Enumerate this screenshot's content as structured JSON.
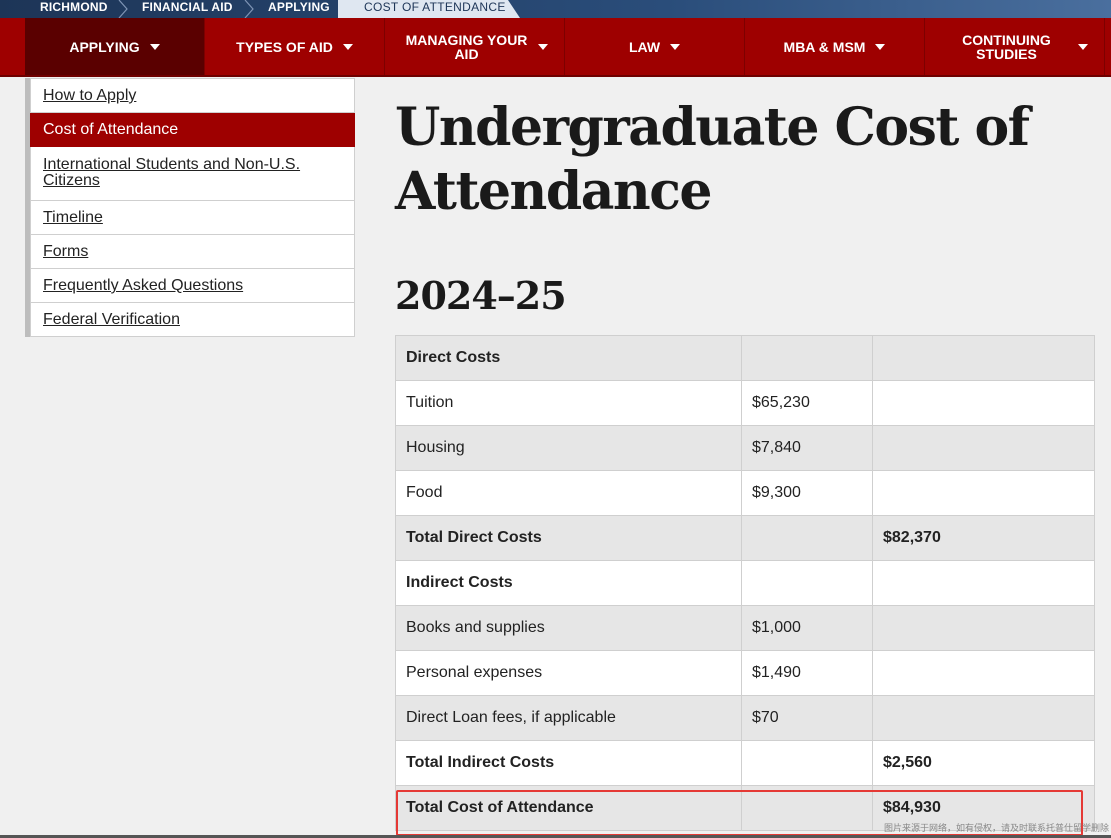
{
  "breadcrumb": {
    "items": [
      "RICHMOND",
      "FINANCIAL AID",
      "APPLYING"
    ],
    "current": "COST OF ATTENDANCE"
  },
  "nav": {
    "items": [
      {
        "label": "APPLYING",
        "active": true
      },
      {
        "label": "TYPES OF AID"
      },
      {
        "label": "MANAGING YOUR AID"
      },
      {
        "label": "LAW"
      },
      {
        "label": "MBA & MSM"
      },
      {
        "label": "CONTINUING STUDIES"
      }
    ]
  },
  "sidebar": {
    "items": [
      {
        "label": "How to Apply"
      },
      {
        "label": "Cost of Attendance",
        "active": true
      },
      {
        "label": "International Students and Non-U.S. Citizens"
      },
      {
        "label": "Timeline"
      },
      {
        "label": "Forms"
      },
      {
        "label": "Frequently Asked Questions"
      },
      {
        "label": "Federal Verification"
      }
    ]
  },
  "main": {
    "title": "Undergraduate Cost of Attendance",
    "year": "2024–25",
    "table": {
      "rows": [
        {
          "label": "Direct Costs",
          "amount": "",
          "total": ""
        },
        {
          "label": "Tuition",
          "amount": "$65,230",
          "total": ""
        },
        {
          "label": "Housing",
          "amount": "$7,840",
          "total": ""
        },
        {
          "label": "Food",
          "amount": "$9,300",
          "total": ""
        },
        {
          "label": "Total Direct Costs",
          "amount": "",
          "total": "$82,370"
        },
        {
          "label": "Indirect Costs",
          "amount": "",
          "total": ""
        },
        {
          "label": "Books and supplies",
          "amount": "$1,000",
          "total": ""
        },
        {
          "label": "Personal expenses",
          "amount": "$1,490",
          "total": ""
        },
        {
          "label": "Direct Loan fees, if applicable",
          "amount": "$70",
          "total": ""
        },
        {
          "label": "Total Indirect Costs",
          "amount": "",
          "total": "$2,560"
        },
        {
          "label": "Total Cost of Attendance",
          "amount": "",
          "total": "$84,930"
        }
      ]
    }
  },
  "watermark": "图片来源于网络，如有侵权，请及时联系托普仕留学删除",
  "colors": {
    "brand_red": "#9e0000",
    "active_nav": "#5a0000",
    "breadcrumb_blue": "#1d3557",
    "highlight": "#e53935"
  }
}
